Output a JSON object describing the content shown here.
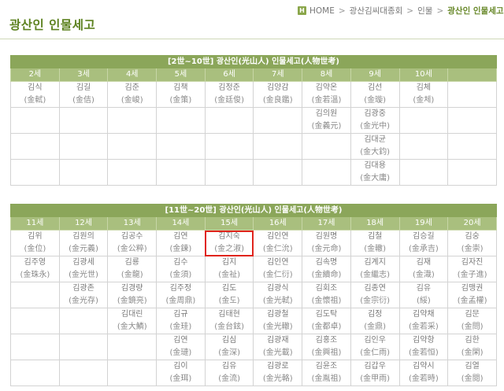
{
  "breadcrumb": {
    "home_icon": "H",
    "home": "HOME",
    "level1": "광산김씨대종회",
    "level2": "인물",
    "current": "광산인 인물세고",
    "separator": ">"
  },
  "page_title": "광산인 인물세고",
  "table1": {
    "title": "[2世~10世] 광산인(光山人) 인물세고(人物世考)",
    "generations": [
      "2세",
      "3세",
      "4세",
      "5세",
      "6세",
      "7세",
      "8세",
      "9세",
      "10세"
    ],
    "rows": [
      [
        {
          "name": "김식",
          "hanja": "(金軾)"
        },
        {
          "name": "김길",
          "hanja": "(金佶)"
        },
        {
          "name": "김준",
          "hanja": "(金峻)"
        },
        {
          "name": "김책",
          "hanja": "(金策)"
        },
        {
          "name": "김정준",
          "hanja": "(金廷俊)"
        },
        {
          "name": "김양감",
          "hanja": "(金良鑑)"
        },
        {
          "name": "김약온",
          "hanja": "(金若溫)"
        },
        {
          "name": "김선",
          "hanja": "(金璇)"
        },
        {
          "name": "김체",
          "hanja": "(金체)"
        },
        null
      ],
      [
        null,
        null,
        null,
        null,
        null,
        null,
        {
          "name": "김의원",
          "hanja": "(金義元)"
        },
        {
          "name": "김광중",
          "hanja": "(金光中)"
        },
        null,
        null
      ],
      [
        null,
        null,
        null,
        null,
        null,
        null,
        null,
        {
          "name": "김대균",
          "hanja": "(金大鈞)"
        },
        null,
        null
      ],
      [
        null,
        null,
        null,
        null,
        null,
        null,
        null,
        {
          "name": "김대용",
          "hanja": "(金大庸)"
        },
        null,
        null
      ]
    ]
  },
  "table2": {
    "title": "[11世~20世] 광산인(光山人) 인물세고(人物世考)",
    "generations": [
      "11세",
      "12세",
      "13세",
      "14세",
      "15세",
      "16세",
      "17세",
      "18세",
      "19세",
      "20세"
    ],
    "rows": [
      [
        {
          "name": "김위",
          "hanja": "(金位)"
        },
        {
          "name": "김원의",
          "hanja": "(金元義)"
        },
        {
          "name": "김공수",
          "hanja": "(金公粹)"
        },
        {
          "name": "김연",
          "hanja": "(金鍊)"
        },
        {
          "name": "김지숙",
          "hanja": "(金之淑)"
        },
        {
          "name": "김인연",
          "hanja": "(金仁沇)"
        },
        {
          "name": "김원명",
          "hanja": "(金元命)"
        },
        {
          "name": "김철",
          "hanja": "(金轍)"
        },
        {
          "name": "김승길",
          "hanja": "(金承吉)"
        },
        {
          "name": "김숭",
          "hanja": "(金崇)"
        }
      ],
      [
        {
          "name": "김주영",
          "hanja": "(金珠永)"
        },
        {
          "name": "김광세",
          "hanja": "(金光世)"
        },
        {
          "name": "김룡",
          "hanja": "(金龍)"
        },
        {
          "name": "김수",
          "hanja": "(金須)"
        },
        {
          "name": "김지",
          "hanja": "(金祉)"
        },
        {
          "name": "김인연",
          "hanja": "(金仁衍)"
        },
        {
          "name": "김속명",
          "hanja": "(金續命)"
        },
        {
          "name": "김계지",
          "hanja": "(金繼志)"
        },
        {
          "name": "김재",
          "hanja": "(金渽)"
        },
        {
          "name": "김자진",
          "hanja": "(金子進)"
        }
      ],
      [
        null,
        {
          "name": "김광존",
          "hanja": "(金光存)"
        },
        {
          "name": "김경량",
          "hanja": "(金鏡亮)"
        },
        {
          "name": "김주정",
          "hanja": "(金周鼎)"
        },
        {
          "name": "김도",
          "hanja": "(金도)"
        },
        {
          "name": "김광식",
          "hanja": "(金光軾)"
        },
        {
          "name": "김회조",
          "hanja": "(金懷祖)"
        },
        {
          "name": "김종연",
          "hanja": "(金宗衍)"
        },
        {
          "name": "김유",
          "hanja": "(綏)"
        },
        {
          "name": "김맹권",
          "hanja": "(金孟權)"
        }
      ],
      [
        null,
        null,
        {
          "name": "김대린",
          "hanja": "(金大鱗)"
        },
        {
          "name": "김규",
          "hanja": "(金珪)"
        },
        {
          "name": "김태현",
          "hanja": "(金台鉉)"
        },
        {
          "name": "김광철",
          "hanja": "(金光轍)"
        },
        {
          "name": "김도탁",
          "hanja": "(金都卓)"
        },
        {
          "name": "김정",
          "hanja": "(金鼎)"
        },
        {
          "name": "김약채",
          "hanja": "(金若采)"
        },
        {
          "name": "김문",
          "hanja": "(金問)"
        }
      ],
      [
        null,
        null,
        null,
        {
          "name": "김연",
          "hanja": "(金璉)"
        },
        {
          "name": "김심",
          "hanja": "(金深)"
        },
        {
          "name": "김광재",
          "hanja": "(金光載)"
        },
        {
          "name": "김홍조",
          "hanja": "(金興祖)"
        },
        {
          "name": "김인우",
          "hanja": "(金仁雨)"
        },
        {
          "name": "김약항",
          "hanja": "(金若恒)"
        },
        {
          "name": "김한",
          "hanja": "(金閑)"
        }
      ],
      [
        null,
        null,
        null,
        {
          "name": "김이",
          "hanja": "(金珥)"
        },
        {
          "name": "김유",
          "hanja": "(金流)"
        },
        {
          "name": "김광로",
          "hanja": "(金光輅)"
        },
        {
          "name": "김윤조",
          "hanja": "(金胤祖)"
        },
        {
          "name": "김갑우",
          "hanja": "(金甲雨)"
        },
        {
          "name": "김약시",
          "hanja": "(金若時)"
        },
        {
          "name": "김열",
          "hanja": "(金閱)"
        }
      ]
    ]
  }
}
